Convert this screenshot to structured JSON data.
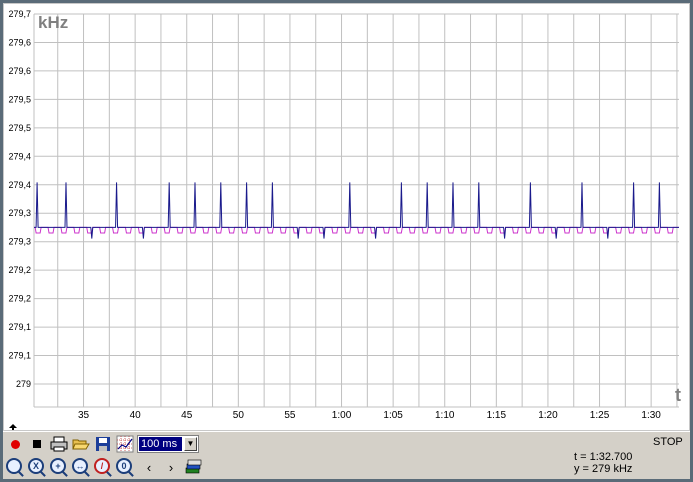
{
  "chart_data": {
    "type": "line",
    "ylabel": "kHz",
    "xlabel": "t",
    "x_tick_labels": [
      "35",
      "40",
      "45",
      "50",
      "55",
      "1:00",
      "1:05",
      "1:10",
      "1:15",
      "1:20",
      "1:25",
      "1:30",
      "1:3"
    ],
    "y_tick_labels": [
      "279,7",
      "279,6",
      "279,6",
      "279,5",
      "279,5",
      "279,4",
      "279,4",
      "279,3",
      "279,3",
      "279,2",
      "279,2",
      "279,1",
      "279,1",
      "279"
    ],
    "x_range_seconds": [
      30.2,
      92.7
    ],
    "y_range": [
      279.0,
      279.7
    ],
    "series": [
      {
        "color": "#1a1a8c",
        "baseline": 279.32,
        "spike_peak": 279.4,
        "spike_mid": 279.3,
        "spikes": [
          {
            "t": 30.5,
            "peak": 279.4
          },
          {
            "t": 33.3,
            "peak": 279.4
          },
          {
            "t": 35.8,
            "peak": 279.3
          },
          {
            "t": 38.2,
            "peak": 279.4
          },
          {
            "t": 40.8,
            "peak": 279.3
          },
          {
            "t": 43.3,
            "peak": 279.4
          },
          {
            "t": 45.8,
            "peak": 279.4
          },
          {
            "t": 48.3,
            "peak": 279.4
          },
          {
            "t": 50.8,
            "peak": 279.4
          },
          {
            "t": 53.3,
            "peak": 279.4
          },
          {
            "t": 55.8,
            "peak": 279.3
          },
          {
            "t": 58.3,
            "peak": 279.3
          },
          {
            "t": 60.8,
            "peak": 279.4
          },
          {
            "t": 63.3,
            "peak": 279.3
          },
          {
            "t": 65.8,
            "peak": 279.4
          },
          {
            "t": 68.3,
            "peak": 279.4
          },
          {
            "t": 70.8,
            "peak": 279.4
          },
          {
            "t": 73.3,
            "peak": 279.4
          },
          {
            "t": 75.8,
            "peak": 279.3
          },
          {
            "t": 78.3,
            "peak": 279.4
          },
          {
            "t": 80.8,
            "peak": 279.3
          },
          {
            "t": 83.3,
            "peak": 279.4
          },
          {
            "t": 85.8,
            "peak": 279.3
          },
          {
            "t": 88.3,
            "peak": 279.4
          },
          {
            "t": 90.8,
            "peak": 279.4
          }
        ]
      },
      {
        "color": "#cc33cc",
        "baseline": 279.32,
        "dip": 279.31,
        "dips_per_second": 0.8
      }
    ],
    "grid": true
  },
  "toolbar": {
    "rate_value": "100 ms",
    "record_icon": "record-icon",
    "stop_icon": "stop-icon",
    "print_icon": "print-icon",
    "open_icon": "open-folder-icon",
    "save_icon": "save-disk-icon",
    "settings_icon": "grid-settings-icon",
    "zoom_labels": [
      "",
      "X",
      "+",
      "",
      "",
      "0"
    ]
  },
  "status": {
    "state": "STOP",
    "time": "t = 1:32.700",
    "value": "y = 279 kHz"
  },
  "colors": {
    "background": "#5a6b78",
    "grid": "#c0c0c0",
    "axis_label": "#808080",
    "blue_series": "#1a1a8c",
    "magenta_series": "#cc33cc",
    "record": "#e00000"
  }
}
